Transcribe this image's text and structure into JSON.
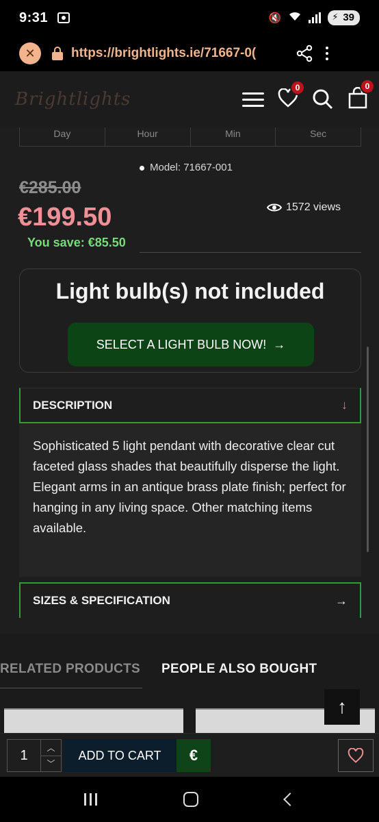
{
  "status_bar": {
    "time": "9:31",
    "battery": "39"
  },
  "browser": {
    "url": "https://brightlights.ie/71667-0("
  },
  "site_header": {
    "logo_text": "Brightlights",
    "wishlist_count": "0",
    "cart_count": "0"
  },
  "countdown": {
    "labels": [
      "Day",
      "Hour",
      "Min",
      "Sec"
    ]
  },
  "product": {
    "model": "Model: 71667-001",
    "old_price": "€285.00",
    "new_price": "€199.50",
    "you_save": "You save: €85.50",
    "views": "1572 views"
  },
  "bulb_notice": {
    "title": "Light bulb(s) not included",
    "button_label": "SELECT A LIGHT BULB NOW!",
    "button_arrow": "→"
  },
  "description": {
    "label": "DESCRIPTION",
    "arrow": "↓",
    "text": "Sophisticated 5 light pendant with decorative clear cut faceted glass shades that beautifully disperse the light. Elegant arms in an antique brass plate finish; perfect for hanging in any living space. Other matching items available."
  },
  "specs": {
    "label": "SIZES & SPECIFICATION",
    "arrow": "→"
  },
  "tabs": {
    "related": "RELATED PRODUCTS",
    "bought": "PEOPLE ALSO BOUGHT"
  },
  "scroll_top": "↑",
  "cart_bar": {
    "quantity": "1",
    "add_to_cart": "ADD TO CART",
    "currency": "€"
  },
  "colors": {
    "accent_green": "#2f9e3a",
    "price_pink": "#ef8f96",
    "save_green": "#76dc7a",
    "url_peach": "#f2b48c",
    "badge_red": "#c0121c"
  }
}
